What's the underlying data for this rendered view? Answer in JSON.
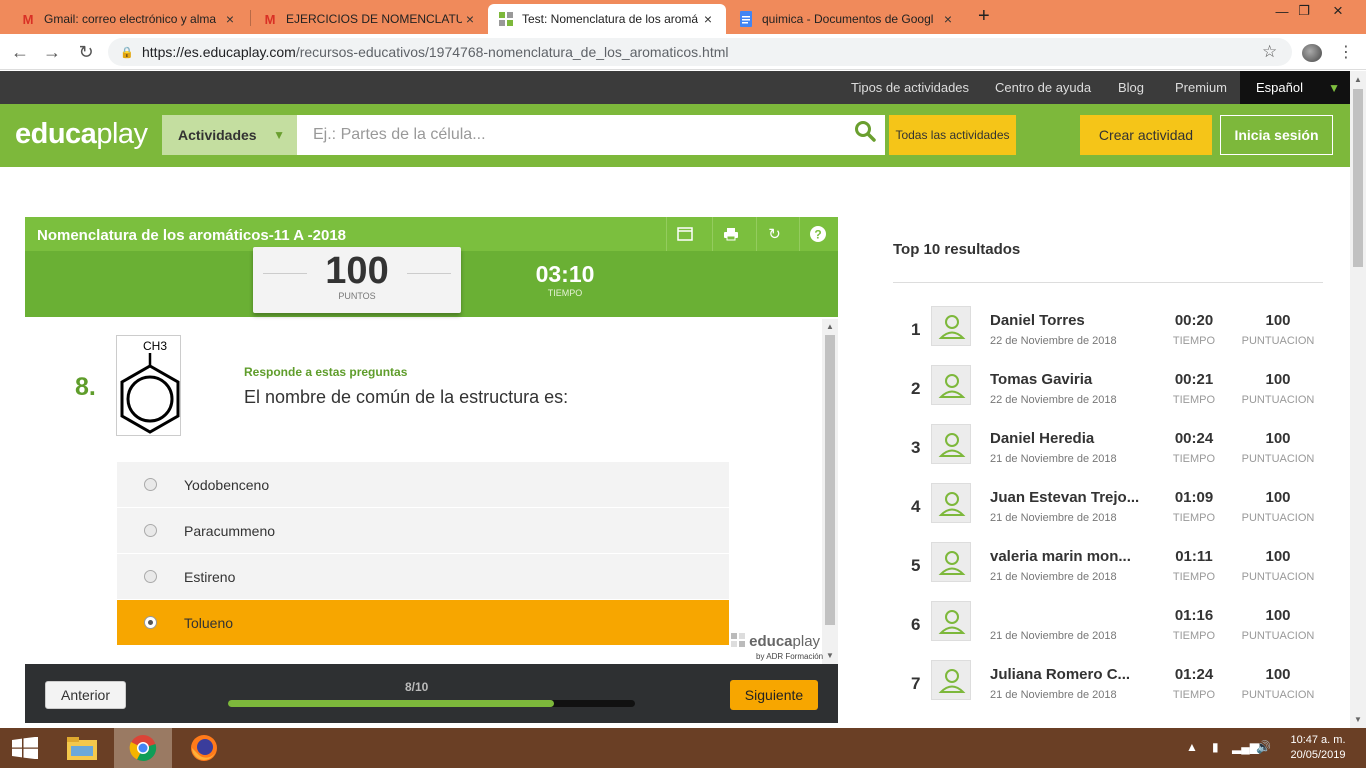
{
  "browser": {
    "tabs": [
      {
        "title": "Gmail: correo electrónico y alma",
        "icon": "gmail-icon"
      },
      {
        "title": "EJERCICIOS DE NOMENCLATURA",
        "icon": "gmail-icon"
      },
      {
        "title": "Test: Nomenclatura de los aromá",
        "icon": "educaplay-icon"
      },
      {
        "title": "quimica - Documentos de Googl",
        "icon": "google-docs-icon"
      }
    ],
    "url_host": "https://es.educaplay.com",
    "url_path": "/recursos-educativos/1974768-nomenclatura_de_los_aromaticos.html"
  },
  "topnav": {
    "items": [
      "Tipos de actividades",
      "Centro de ayuda",
      "Blog",
      "Premium"
    ],
    "language": "Español"
  },
  "header": {
    "logo_a": "educa",
    "logo_b": "play",
    "category": "Actividades",
    "search_placeholder": "Ej.: Partes de la célula...",
    "all_activities": "Todas las actividades",
    "create": "Crear actividad",
    "login": "Inicia sesión"
  },
  "activity": {
    "title": "Nomenclatura de los aromáticos-11 A -2018",
    "points_value": "100",
    "points_label": "PUNTOS",
    "timer_value": "03:10",
    "timer_label": "TIEMPO",
    "question_number": "8.",
    "image_label": "CH3",
    "hint": "Responde a estas preguntas",
    "question": "El nombre de común de la estructura es:",
    "options": [
      {
        "label": "Yodobenceno",
        "selected": false
      },
      {
        "label": "Paracummeno",
        "selected": false
      },
      {
        "label": "Estireno",
        "selected": false
      },
      {
        "label": "Tolueno",
        "selected": true
      }
    ],
    "watermark_a": "educa",
    "watermark_b": "play",
    "watermark_sub": "by ADR Formación",
    "prev": "Anterior",
    "progress_label": "8/10",
    "progress": 0.8,
    "next": "Siguiente"
  },
  "ranking": {
    "title": "Top 10 resultados",
    "time_label": "TIEMPO",
    "score_label": "PUNTUACION",
    "rows": [
      {
        "pos": "1",
        "name": "Daniel Torres",
        "date": "22 de Noviembre de 2018",
        "time": "00:20",
        "score": "100"
      },
      {
        "pos": "2",
        "name": "Tomas Gaviria",
        "date": "22 de Noviembre de 2018",
        "time": "00:21",
        "score": "100"
      },
      {
        "pos": "3",
        "name": "Daniel Heredia",
        "date": "21 de Noviembre de 2018",
        "time": "00:24",
        "score": "100"
      },
      {
        "pos": "4",
        "name": "Juan Estevan Trejo...",
        "date": "21 de Noviembre de 2018",
        "time": "01:09",
        "score": "100"
      },
      {
        "pos": "5",
        "name": "valeria marin mon...",
        "date": "21 de Noviembre de 2018",
        "time": "01:11",
        "score": "100"
      },
      {
        "pos": "6",
        "name": "",
        "date": "21 de Noviembre de 2018",
        "time": "01:16",
        "score": "100"
      },
      {
        "pos": "7",
        "name": "Juliana Romero C...",
        "date": "21 de Noviembre de 2018",
        "time": "01:24",
        "score": "100"
      }
    ]
  },
  "taskbar": {
    "time": "10:47 a. m.",
    "date": "20/05/2019"
  },
  "colors": {
    "green": "#7db83b",
    "yellow": "#f5c518",
    "orange": "#f7a600",
    "chrome_tab": "#f08a5b"
  }
}
